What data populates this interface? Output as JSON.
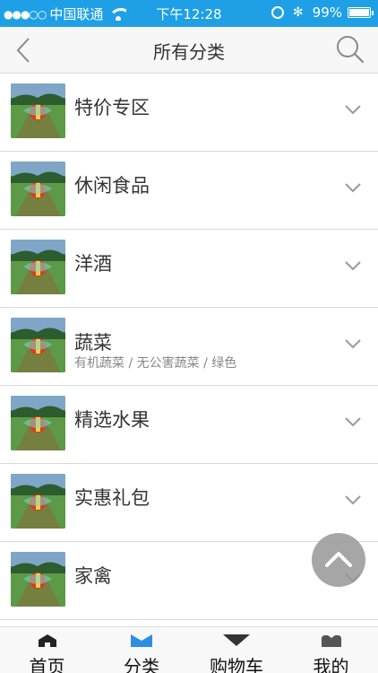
{
  "status_bar": {
    "signal": "●●●○○",
    "carrier": "中国联通",
    "time": "下午12:28",
    "bluetooth_icon": "✻",
    "battery": "99%",
    "battery_level": 0.99,
    "background": "#1fa0e6"
  },
  "nav": {
    "title": "所有分类",
    "back_icon": "chevron-left-icon",
    "search_icon": "search-icon"
  },
  "categories": [
    {
      "label": "特价专区",
      "sub": ""
    },
    {
      "label": "休闲食品",
      "sub": ""
    },
    {
      "label": "洋酒",
      "sub": ""
    },
    {
      "label": "蔬菜",
      "sub": "有机蔬菜 / 无公害蔬菜 / 绿色"
    },
    {
      "label": "精选水果",
      "sub": ""
    },
    {
      "label": "实惠礼包",
      "sub": ""
    },
    {
      "label": "家禽",
      "sub": ""
    }
  ],
  "tabs": [
    {
      "label": "首页",
      "icon": "home-icon"
    },
    {
      "label": "分类",
      "icon": "category-icon",
      "active": true
    },
    {
      "label": "购物车",
      "icon": "cart-icon"
    },
    {
      "label": "我的",
      "icon": "profile-icon"
    }
  ],
  "colors": {
    "accent": "#2f8ee0",
    "divider": "#d9d9d9"
  }
}
